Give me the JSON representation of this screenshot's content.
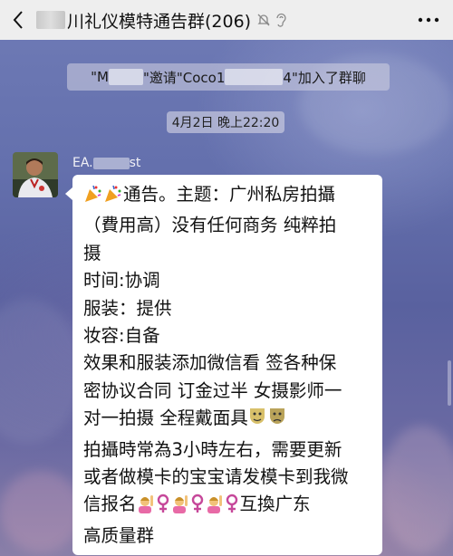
{
  "header": {
    "title_prefix": "",
    "title_main": "川礼仪模特通告群(206)",
    "icons": [
      "back-icon",
      "mute-bell-icon",
      "ear-icon",
      "more-icon"
    ]
  },
  "system_message": {
    "part1": "\"M",
    "part2": "\"邀请\"Coco1",
    "part3": "4\"加入了群聊"
  },
  "timestamp": "4月2日 晚上22:20",
  "message": {
    "sender_prefix": "EA.",
    "sender_suffix": "st",
    "lines": [
      "通告。主题：广州私房拍攝",
      "（費用高）没有任何商务 纯粹拍",
      "摄",
      "时间:协调",
      "服装：提供",
      "妆容:自备",
      "效果和服装添加微信看 签各种保",
      "密协议合同 订金过半 女摄影师一",
      "对一拍摄 全程戴面具",
      "拍攝時常為3小時左右，需要更新",
      "或者做模卡的宝宝请发模卡到我微",
      "信报名",
      "互換广东",
      "高质量群"
    ]
  },
  "colors": {
    "header_bg": "#eeeeee",
    "bubble_bg": "#ffffff",
    "wallpaper": "#6470ad"
  }
}
